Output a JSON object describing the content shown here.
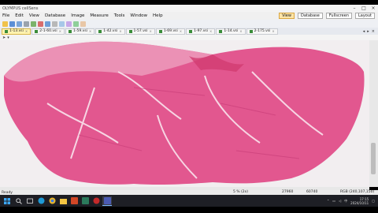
{
  "window": {
    "title": "OLYMPUS cellSens"
  },
  "menu": {
    "items": [
      "File",
      "Edit",
      "View",
      "Database",
      "Image",
      "Measure",
      "Tools",
      "Window",
      "Help"
    ],
    "layout_buttons": [
      "View",
      "Database",
      "Fullscreen"
    ],
    "layout_selector": "Layout"
  },
  "tabs": [
    {
      "label": "1-13.vsi",
      "active": true
    },
    {
      "label": "2-1-60.vsi",
      "active": false
    },
    {
      "label": "1-59.vsi",
      "active": false
    },
    {
      "label": "1-42.vsi",
      "active": false
    },
    {
      "label": "1-57.vsi",
      "active": false
    },
    {
      "label": "1-69.vsi",
      "active": false
    },
    {
      "label": "1-97.vsi",
      "active": false
    },
    {
      "label": "1-14.vsi",
      "active": false
    },
    {
      "label": "2-175.vsi",
      "active": false
    }
  ],
  "status": {
    "left": "Ready",
    "zoom": "5 % (2x)",
    "x": "27960",
    "y": "60740",
    "rgb": "RGB (240,107,150)"
  },
  "taskbar": {
    "time": "17:15",
    "date": "2024/10/11",
    "lang": "中"
  },
  "colors": {
    "tissue": "#e2578f",
    "tissue_dark": "#c63b76",
    "background": "#f2eef0"
  }
}
